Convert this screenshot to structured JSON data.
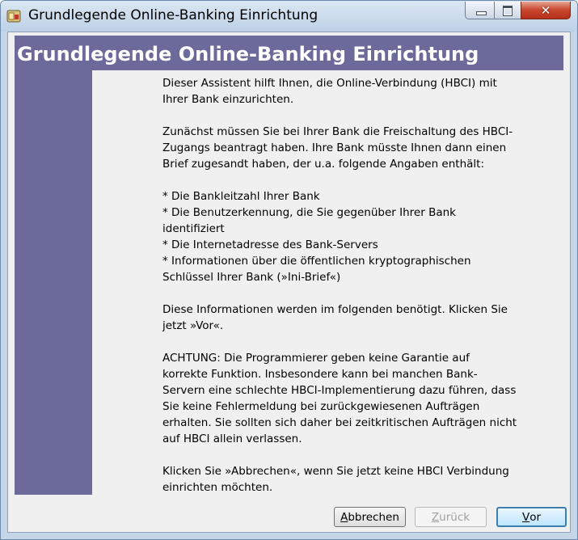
{
  "window": {
    "title": "Grundlegende Online-Banking Einrichtung",
    "app_icon": "hbci-wizard-icon",
    "controls": {
      "minimize_icon": "minimize-icon",
      "maximize_icon": "maximize-icon",
      "close_icon": "close-icon",
      "close_glyph": "✕"
    }
  },
  "banner": {
    "title": "Grundlegende Online-Banking Einrichtung"
  },
  "content": {
    "para1": "Dieser Assistent hilft Ihnen, die Online-Verbindung (HBCI) mit Ihrer Bank einzurichten.",
    "para2": "Zunächst müssen Sie bei Ihrer Bank die Freischaltung des HBCI-Zugangs beantragt haben. Ihre Bank müsste Ihnen dann einen Brief zugesandt haben, der u.a. folgende Angaben enthält:",
    "list": [
      "* Die Bankleitzahl Ihrer Bank",
      "* Die Benutzerkennung, die Sie gegenüber Ihrer Bank identifiziert",
      "* Die Internetadresse des Bank-Servers",
      "* Informationen über die öffentlichen kryptographischen Schlüssel Ihrer Bank (»Ini-Brief«)"
    ],
    "para3": "Diese Informationen werden im folgenden benötigt. Klicken Sie jetzt »Vor«.",
    "para4": "ACHTUNG: Die Programmierer geben keine Garantie auf korrekte Funktion. Insbesondere kann bei manchen Bank-Servern eine schlechte HBCI-Implementierung dazu führen, dass Sie keine Fehlermeldung bei zurückgewiesenen Aufträgen erhalten. Sie sollten sich daher bei zeitkritischen Aufträgen nicht auf HBCI allein verlassen.",
    "para5": "Klicken Sie »Abbrechen«, wenn Sie jetzt keine HBCI Verbindung einrichten möchten."
  },
  "buttons": {
    "cancel": {
      "mnemonic": "A",
      "rest": "bbrechen"
    },
    "back": {
      "mnemonic": "Z",
      "rest": "urück",
      "enabled": false
    },
    "next": {
      "mnemonic": "V",
      "rest": "or"
    }
  },
  "colors": {
    "banner": "#6b6a9b",
    "dialog_bg": "#f0f0f0",
    "default_button_border": "#3c7fb1"
  }
}
